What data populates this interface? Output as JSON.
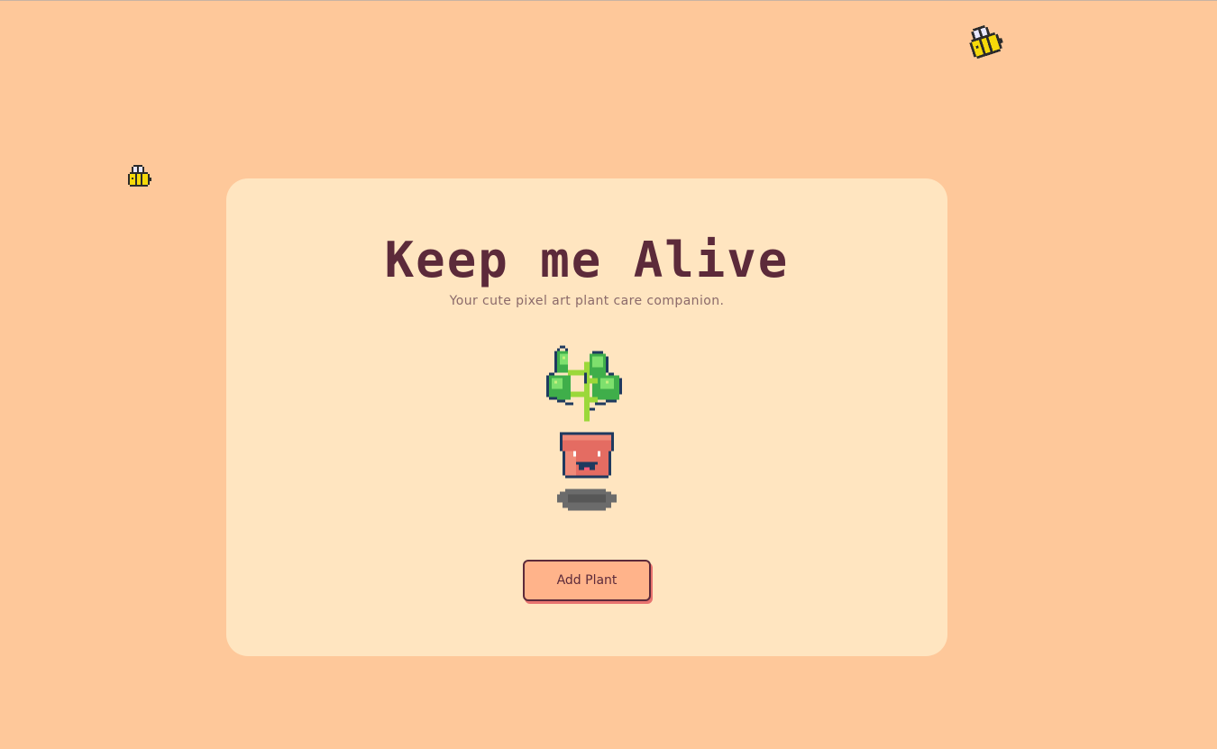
{
  "header": {
    "title": "Keep me Alive",
    "subtitle": "Your cute pixel art plant care companion."
  },
  "actions": {
    "add_plant_label": "Add Plant"
  },
  "colors": {
    "background": "#fec89a",
    "card": "#ffe5c0",
    "title_text": "#5c2a3a",
    "subtitle_text": "#8b6a6a",
    "button_fill": "#ffb38a",
    "button_shadow": "#e8736f"
  },
  "decorations": {
    "bees": [
      "bee-icon",
      "bee-icon"
    ],
    "plant": "potted-plant-pixel-art"
  }
}
